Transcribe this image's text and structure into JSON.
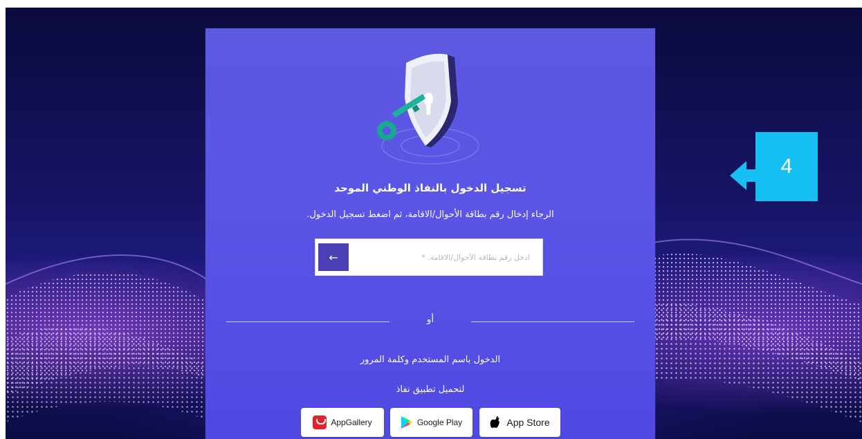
{
  "login": {
    "title": "تسجيل الدخول بالنفاذ الوطني الموحد",
    "subtitle": "الرجاء إدخال رقم بطاقة الأحوال/الاقامة، ثم اضغط تسجيل الدخول.",
    "id_input_placeholder": "ادخل رقم بطاقة الأحوال/الاقامة. *",
    "id_input_value": "",
    "submit_icon": "arrow-left-icon",
    "or_label": "أو",
    "alt_login_link": "الدخول باسم المستخدم وكلمة المرور",
    "download_label": "لتحميل تطبيق نفاذ"
  },
  "stores": {
    "appgallery": "AppGallery",
    "googleplay": "Google Play",
    "appstore": "App Store"
  },
  "annotation": {
    "step_number": "4",
    "color": "#17c0f2"
  },
  "colors": {
    "card_bg": "#5a55e6",
    "submit_bg": "#4a3fb5"
  }
}
